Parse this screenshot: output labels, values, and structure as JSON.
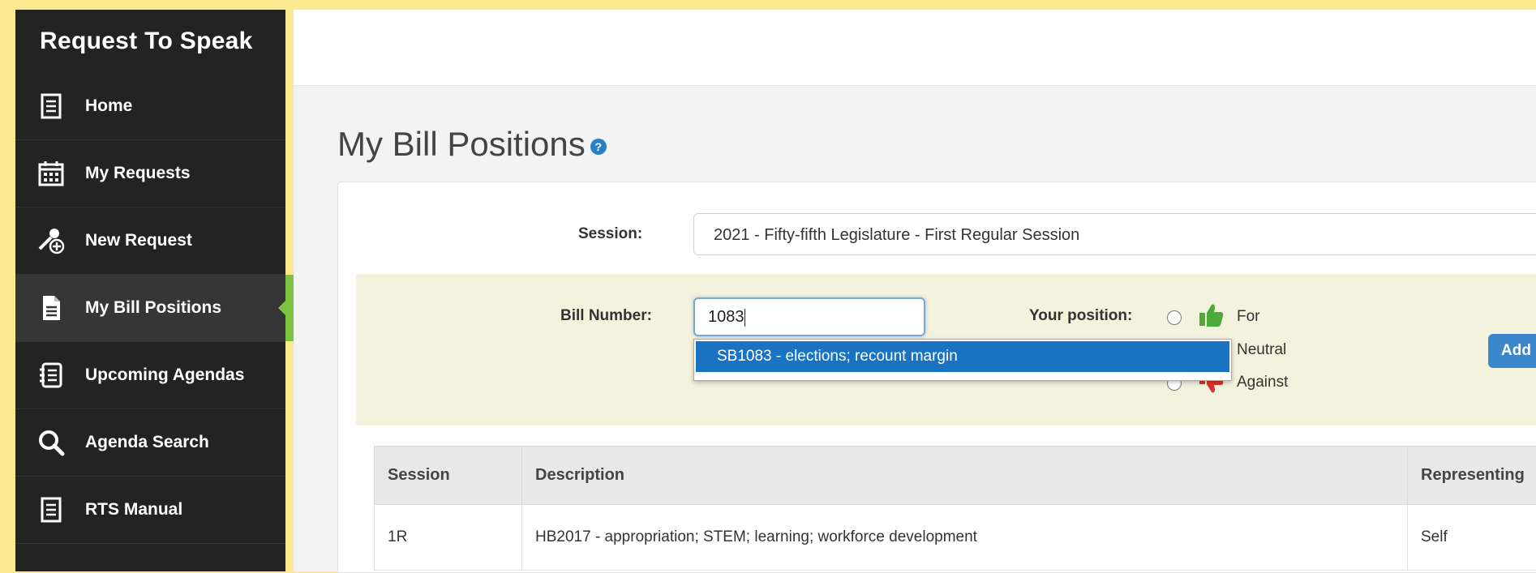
{
  "app": {
    "title": "Request To Speak"
  },
  "sidebar": {
    "items": [
      {
        "label": "Home",
        "icon": "home-icon"
      },
      {
        "label": "My Requests",
        "icon": "calendar-icon"
      },
      {
        "label": "New Request",
        "icon": "new-request-icon"
      },
      {
        "label": "My Bill Positions",
        "icon": "document-icon",
        "active": true
      },
      {
        "label": "Upcoming Agendas",
        "icon": "agenda-icon"
      },
      {
        "label": "Agenda Search",
        "icon": "search-icon"
      },
      {
        "label": "RTS Manual",
        "icon": "manual-icon"
      }
    ]
  },
  "page": {
    "title": "My Bill Positions",
    "help": "?"
  },
  "form": {
    "session_label": "Session:",
    "session_value": "2021 - Fifty-fifth Legislature - First Regular Session",
    "bill_label": "Bill Number:",
    "bill_value": "1083",
    "position_label": "Your position:",
    "positions": [
      "For",
      "Neutral",
      "Against"
    ],
    "add_label": "Add",
    "autocomplete_option": "SB1083 - elections; recount margin"
  },
  "table": {
    "headers": [
      "Session",
      "Description",
      "Representing"
    ],
    "rows": [
      [
        "1R",
        "HB2017 - appropriation; STEM; learning; workforce development",
        "Self"
      ]
    ]
  },
  "colors": {
    "accent": "#7cc243",
    "brand_dark": "#232323",
    "selection_blue": "#1a73c0",
    "background_yellow": "#fbe98f"
  }
}
